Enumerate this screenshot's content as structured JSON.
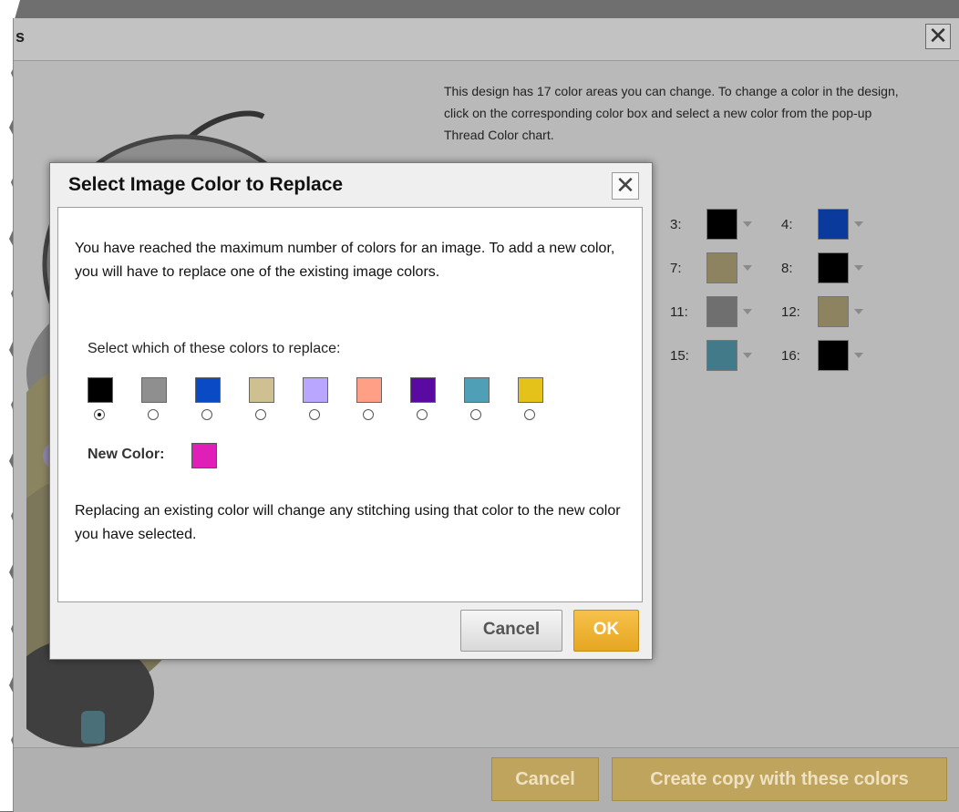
{
  "parent": {
    "title_fragment": "s",
    "close_glyph": "✕",
    "instructions": "This design has 17 color areas you can change. To change a color in the design, click on the corresponding color box and select a new color from the pop-up Thread Color chart.",
    "swatch_rows": [
      [
        {
          "label": "3:",
          "color": "#000000"
        },
        {
          "label": "4:",
          "color": "#0a3a9c"
        }
      ],
      [
        {
          "label": "7:",
          "color": "#8e8360"
        },
        {
          "label": "8:",
          "color": "#000000"
        }
      ],
      [
        {
          "label": "11:",
          "color": "#6f6f6f"
        },
        {
          "label": "12:",
          "color": "#8e8360"
        }
      ],
      [
        {
          "label": "15:",
          "color": "#427a8a"
        },
        {
          "label": "16:",
          "color": "#000000"
        }
      ]
    ],
    "cancel_label": "Cancel",
    "create_label": "Create copy with these colors"
  },
  "modal": {
    "title": "Select Image Color to Replace",
    "close_glyph": "✕",
    "intro": "You have reached the maximum number of colors for an image. To add a new color, you will have to replace one of the existing image colors.",
    "select_label": "Select which of these colors to replace:",
    "colors": [
      {
        "color": "#000000",
        "checked": true
      },
      {
        "color": "#8f8f8f",
        "checked": false
      },
      {
        "color": "#0a4ac4",
        "checked": false
      },
      {
        "color": "#cfc091",
        "checked": false
      },
      {
        "color": "#b9a6ff",
        "checked": false
      },
      {
        "color": "#ff9f86",
        "checked": false
      },
      {
        "color": "#5a0aa0",
        "checked": false
      },
      {
        "color": "#4f9fb6",
        "checked": false
      },
      {
        "color": "#e4c21a",
        "checked": false
      }
    ],
    "new_color_label": "New Color:",
    "new_color": "#e01fb8",
    "note": "Replacing an existing color will change any stitching using that color to the new color you have selected.",
    "cancel_label": "Cancel",
    "ok_label": "OK"
  }
}
